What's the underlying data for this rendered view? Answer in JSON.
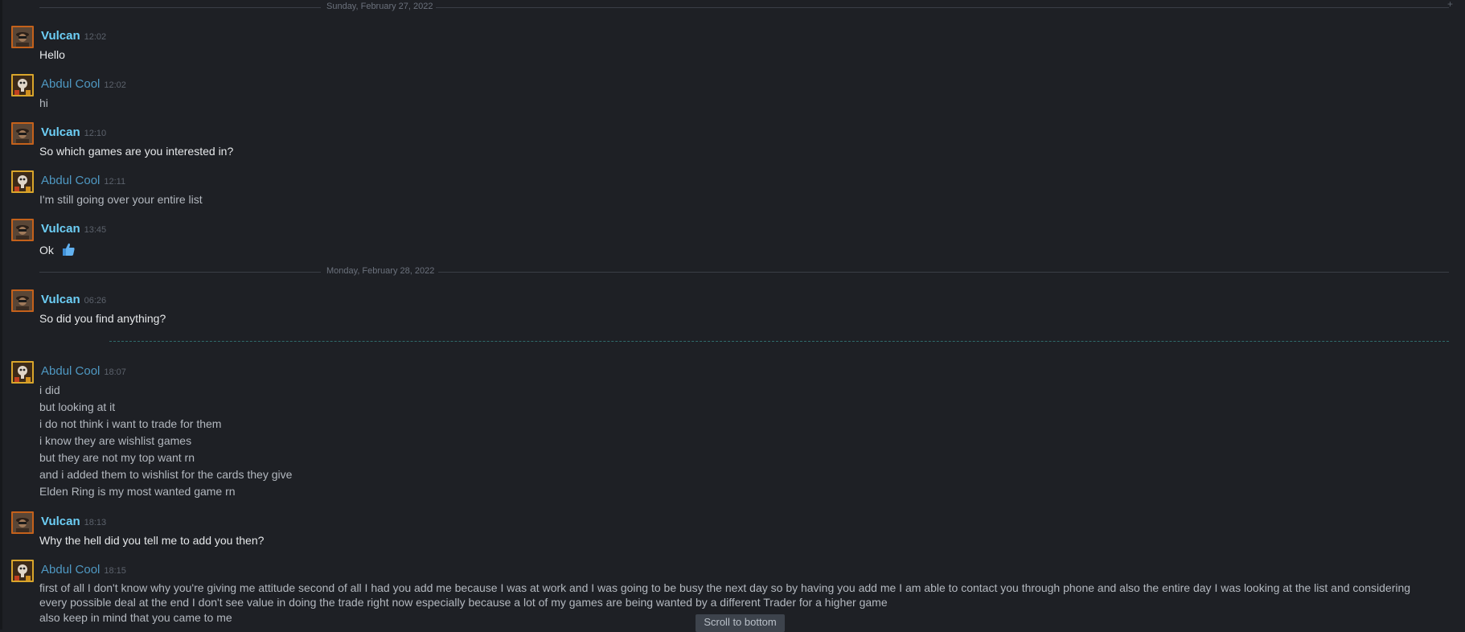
{
  "dividers": {
    "d1": "Sunday, February 27, 2022",
    "d2": "Monday, February 28, 2022"
  },
  "messages": [
    {
      "name": "Vulcan",
      "time": "12:02",
      "lines": [
        "Hello"
      ]
    },
    {
      "name": "Abdul Cool",
      "time": "12:02",
      "lines": [
        "hi"
      ]
    },
    {
      "name": "Vulcan",
      "time": "12:10",
      "lines": [
        "So which games are you interested in?"
      ]
    },
    {
      "name": "Abdul Cool",
      "time": "12:11",
      "lines": [
        "I'm still going over your entire list"
      ]
    },
    {
      "name": "Vulcan",
      "time": "13:45",
      "lines": [
        "Ok"
      ]
    },
    {
      "name": "Vulcan",
      "time": "06:26",
      "lines": [
        "So did you find anything?"
      ]
    },
    {
      "name": "Abdul Cool",
      "time": "18:07",
      "lines": [
        "i did",
        "but looking at it",
        "i do not think i want to trade for them",
        "i know they are wishlist games",
        "but they are not my top want rn",
        "and i added them to wishlist for the cards they give",
        "Elden Ring is my most wanted game rn"
      ]
    },
    {
      "name": "Vulcan",
      "time": "18:13",
      "lines": [
        "Why the hell did you tell me to add you then?"
      ]
    },
    {
      "name": "Abdul Cool",
      "time": "18:15",
      "lines": [
        "first of all I don't know why you're giving me attitude second of all I had you add me because I was at work and I was going to be busy the next day so by having you add me I am able to contact you through phone and also the entire day I was looking at the list and considering every possible deal at the end I don't see value in doing the trade right now especially because a lot of my games are being wanted by a different Trader for a higher game",
        "also keep in mind that you came to me"
      ]
    }
  ],
  "scroll_button": "Scroll to bottom",
  "colors": {
    "background": "#1e2025",
    "vulcan_name": "#6dcff6",
    "abdul_name": "#4f98c2"
  },
  "icons": {
    "emoji": "thumbs-up-icon",
    "avatar_vulcan": "avatar-vulcan",
    "avatar_abdul": "avatar-abdul"
  }
}
